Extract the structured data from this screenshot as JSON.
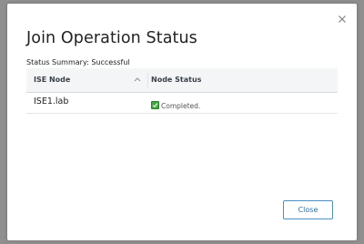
{
  "modal": {
    "title": "Join Operation Status",
    "summary": "Status Summary: Successful",
    "close_icon": "close-icon"
  },
  "table": {
    "columns": [
      "ISE Node",
      "Node Status"
    ],
    "sort_icon": "chevron-up-icon",
    "rows": [
      {
        "node": "ISE1.lab",
        "status": "Completed.",
        "status_icon": "check-icon"
      }
    ]
  },
  "footer": {
    "close_label": "Close"
  },
  "colors": {
    "accent": "#4a8fc4",
    "success": "#44a744"
  }
}
